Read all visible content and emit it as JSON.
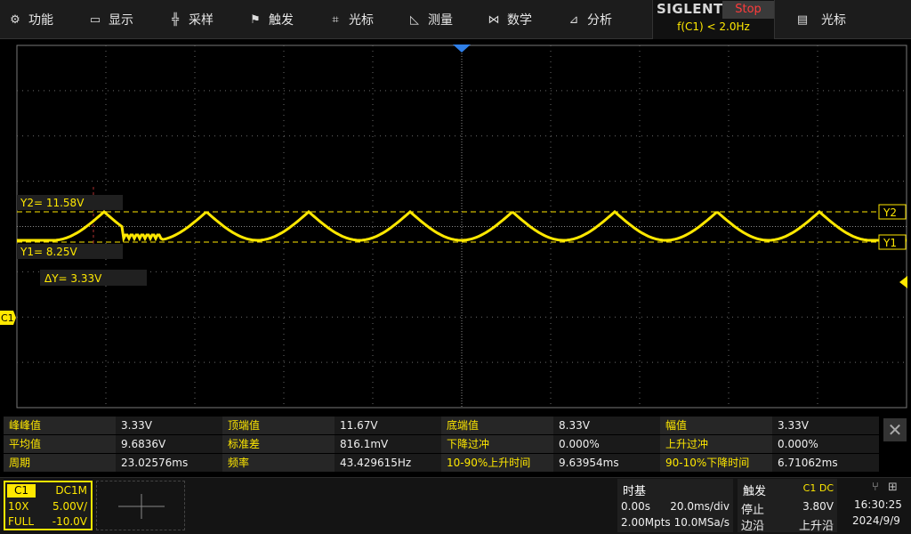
{
  "menu": [
    {
      "label": "功能",
      "icon": "gear-icon"
    },
    {
      "label": "显示",
      "icon": "monitor-icon"
    },
    {
      "label": "采样",
      "icon": "sampling-icon"
    },
    {
      "label": "触发",
      "icon": "flag-icon"
    },
    {
      "label": "光标",
      "icon": "crosshair-icon"
    },
    {
      "label": "测量",
      "icon": "measure-icon"
    },
    {
      "label": "数学",
      "icon": "math-icon"
    },
    {
      "label": "分析",
      "icon": "analysis-icon"
    }
  ],
  "brand": {
    "name": "SIGLENT",
    "run_state": "Stop",
    "trigger_info": "f(C1) < 2.0Hz"
  },
  "cursor_menu": {
    "label": "光标",
    "icon": "cursor-list-icon"
  },
  "cursors": {
    "y2_label": "Y2= 11.58V",
    "y1_label": "Y1= 8.25V",
    "dy_label": "ΔY= 3.33V",
    "y2_tag": "Y2",
    "y1_tag": "Y1"
  },
  "channel_marker": "C1",
  "colors": {
    "trace": "#ffe800",
    "grid": "#7a7a7a",
    "stop": "#ff3b3b",
    "trigger_marker": "#2f7fe8"
  },
  "measurements": [
    [
      {
        "label": "峰峰值",
        "value": "3.33V"
      },
      {
        "label": "顶端值",
        "value": "11.67V"
      },
      {
        "label": "底端值",
        "value": "8.33V"
      },
      {
        "label": "幅值",
        "value": "3.33V"
      }
    ],
    [
      {
        "label": "平均值",
        "value": "9.6836V"
      },
      {
        "label": "标准差",
        "value": "816.1mV"
      },
      {
        "label": "下降过冲",
        "value": "0.000%"
      },
      {
        "label": "上升过冲",
        "value": "0.000%"
      }
    ],
    [
      {
        "label": "周期",
        "value": "23.02576ms"
      },
      {
        "label": "频率",
        "value": "43.429615Hz"
      },
      {
        "label": "10-90%上升时间",
        "value": "9.63954ms"
      },
      {
        "label": "90-10%下降时间",
        "value": "6.71062ms"
      }
    ]
  ],
  "channel": {
    "name": "C1",
    "coupling": "DC1M",
    "probe": "10X",
    "scale": "5.00V/",
    "bandwidth": "FULL",
    "offset": "-10.0V"
  },
  "timebase": {
    "title": "时基",
    "delay": "0.00s",
    "scale": "20.0ms/div",
    "memory": "2.00Mpts",
    "sample_rate": "10.0MSa/s"
  },
  "trigger": {
    "title": "触发",
    "source": "C1 DC",
    "state": "停止",
    "level": "3.80V",
    "type": "边沿",
    "slope": "上升沿"
  },
  "clock": {
    "time": "16:30:25",
    "date": "2024/9/9"
  }
}
